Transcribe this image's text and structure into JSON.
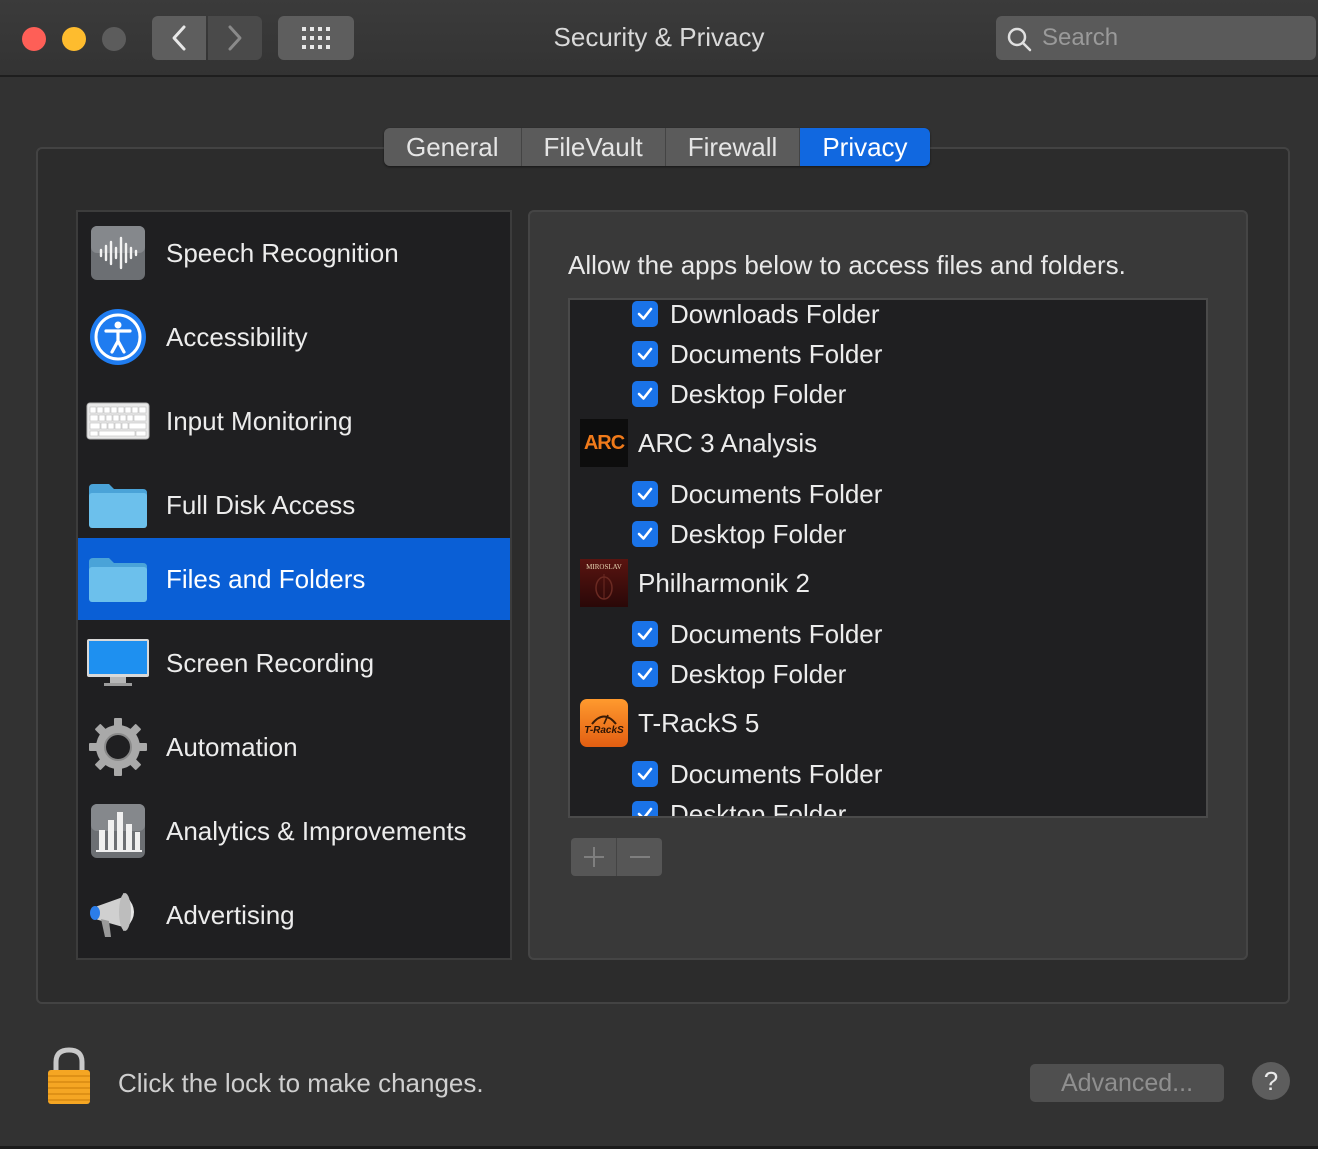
{
  "window": {
    "title": "Security & Privacy",
    "search_placeholder": "Search"
  },
  "tabs": [
    {
      "label": "General"
    },
    {
      "label": "FileVault"
    },
    {
      "label": "Firewall"
    },
    {
      "label": "Privacy",
      "active": true
    }
  ],
  "sidebar": {
    "items": [
      {
        "label": "Speech Recognition",
        "icon": "waveform-icon"
      },
      {
        "label": "Accessibility",
        "icon": "accessibility-icon"
      },
      {
        "label": "Input Monitoring",
        "icon": "keyboard-icon"
      },
      {
        "label": "Full Disk Access",
        "icon": "folder-icon"
      },
      {
        "label": "Files and Folders",
        "icon": "folder-icon",
        "selected": true
      },
      {
        "label": "Screen Recording",
        "icon": "display-icon"
      },
      {
        "label": "Automation",
        "icon": "gear-icon"
      },
      {
        "label": "Analytics & Improvements",
        "icon": "bar-chart-icon"
      },
      {
        "label": "Advertising",
        "icon": "megaphone-icon"
      }
    ]
  },
  "panel": {
    "heading": "Allow the apps below to access files and folders.",
    "rows": [
      {
        "type": "folder",
        "label": "Downloads Folder",
        "checked": true
      },
      {
        "type": "folder",
        "label": "Documents Folder",
        "checked": true
      },
      {
        "type": "folder",
        "label": "Desktop Folder",
        "checked": true
      },
      {
        "type": "app",
        "label": "ARC 3 Analysis",
        "icon": "arc-app-icon",
        "icon_text": "ARC"
      },
      {
        "type": "folder",
        "label": "Documents Folder",
        "checked": true
      },
      {
        "type": "folder",
        "label": "Desktop Folder",
        "checked": true
      },
      {
        "type": "app",
        "label": "Philharmonik 2",
        "icon": "philharmonik-app-icon",
        "icon_text": "MIROSLAV"
      },
      {
        "type": "folder",
        "label": "Documents Folder",
        "checked": true
      },
      {
        "type": "folder",
        "label": "Desktop Folder",
        "checked": true
      },
      {
        "type": "app",
        "label": "T-RackS 5",
        "icon": "tracks-app-icon",
        "icon_text": "T-RackS"
      },
      {
        "type": "folder",
        "label": "Documents Folder",
        "checked": true
      },
      {
        "type": "folder",
        "label": "Desktop Folder",
        "checked": true
      }
    ]
  },
  "footer": {
    "lock_text": "Click the lock to make changes.",
    "advanced_label": "Advanced...",
    "help_label": "?"
  },
  "colors": {
    "accent": "#0a5fd6",
    "checkbox": "#1a73e8",
    "close": "#fe5f57",
    "minimize": "#febc2e"
  }
}
